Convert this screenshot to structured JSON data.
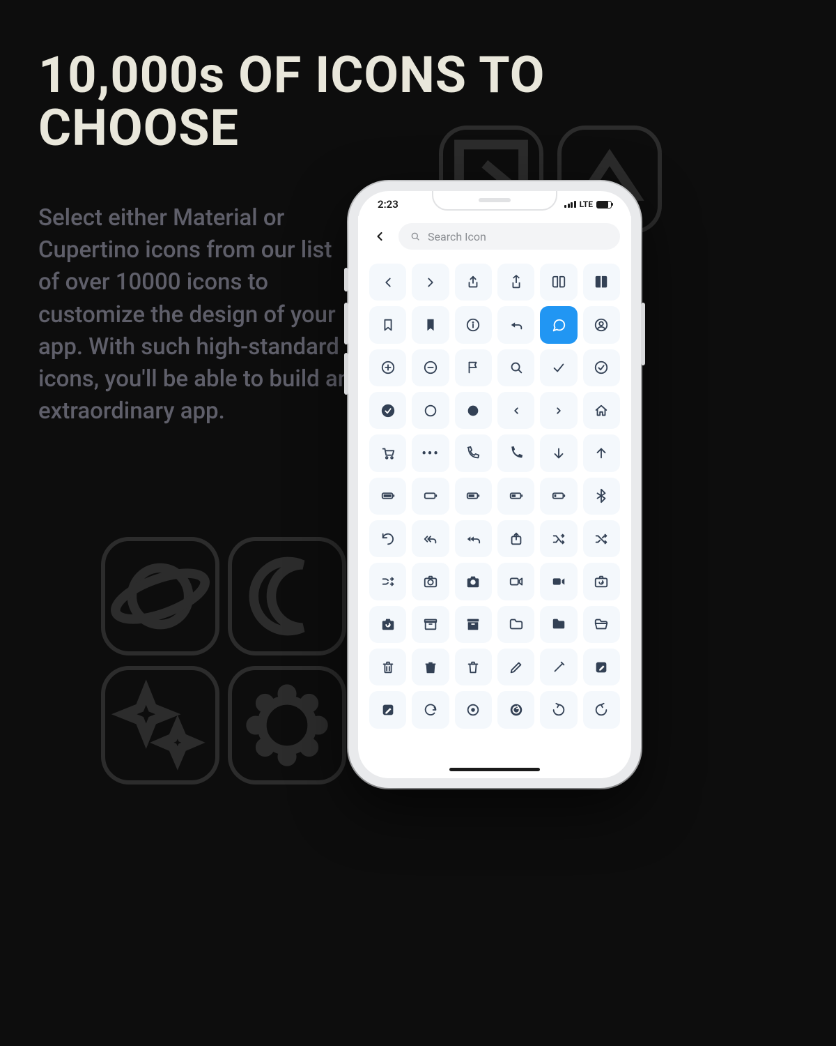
{
  "headline": "10,000s OF ICONS TO CHOOSE",
  "body": "Select either Material or Cupertino icons from our list of over 10000 icons to customize the design of your app. With such high-standard icons, you'll be able to build an extraordinary app.",
  "bg_tiles": [
    "angle-right",
    "triangle-up",
    "planet",
    "moon",
    "sparkles",
    "gear"
  ],
  "phone": {
    "status": {
      "time": "2:23",
      "net": "LTE"
    },
    "search": {
      "placeholder": "Search Icon"
    },
    "selected_index": 10,
    "icons": [
      "chevron-left",
      "chevron-right",
      "share-up",
      "share-up-fill",
      "book-open",
      "book-fill",
      "bookmark",
      "bookmark-fill",
      "info-circle",
      "reply",
      "chat-bubble",
      "user-circle",
      "plus-circle",
      "minus-circle",
      "flag",
      "search",
      "check",
      "check-circle",
      "check-circle-fill",
      "circle",
      "circle-fill",
      "chevron-left-small",
      "chevron-right-small",
      "home",
      "cart",
      "ellipsis",
      "phone",
      "phone-fill",
      "arrow-down",
      "arrow-up",
      "battery-full",
      "battery-empty",
      "battery-75",
      "battery-50",
      "battery-25",
      "bluetooth",
      "undo",
      "reply-all",
      "reply-all-fill",
      "share-box",
      "shuffle",
      "shuffle-alt",
      "shuffle-2",
      "camera",
      "camera-fill",
      "video",
      "video-fill",
      "camera-rotate",
      "camera-rotate-fill",
      "archive",
      "archive-fill",
      "folder",
      "folder-fill",
      "folder-open",
      "trash",
      "trash-fill",
      "trash-alt",
      "pencil",
      "pencil-alt",
      "edit-square",
      "edit-square-fill",
      "refresh-cw",
      "target",
      "refresh-ccw-fill",
      "rotate-cw",
      "rotate-ccw"
    ]
  }
}
